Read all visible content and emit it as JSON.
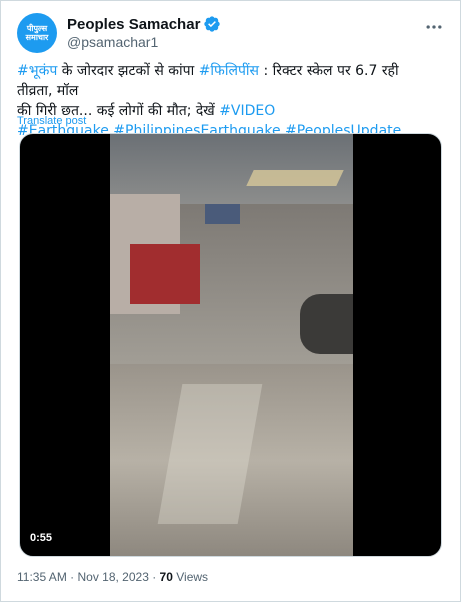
{
  "author": {
    "avatar_line1": "पीपुल्स",
    "avatar_line2": "समाचार",
    "display_name": "Peoples Samachar",
    "handle": "@psamachar1"
  },
  "tweet": {
    "line1_tag": "#भूकंप",
    "line1_text": " के जोरदार झटकों से कांपा ",
    "line1_tag2": "#फिलिपींस",
    "line1_text2": " : रिक्टर स्केल पर 6.7 रही तीव्रता, मॉल",
    "line2_text": "की गिरी छत... कई लोगों की मौत; देखें ",
    "line2_tag": "#VIDEO",
    "line3_tag1": "#Earthquake",
    "line3_tag2": "#PhilippinesEarthquake",
    "line3_tag3": "#PeoplesUpdate",
    "translate_label": "Translate post"
  },
  "video": {
    "time": "0:55"
  },
  "meta": {
    "time": "11:35 AM",
    "date": "Nov 18, 2023",
    "separator": " · ",
    "views_count": "70",
    "views_label": " Views"
  },
  "colors": {
    "accent": "#1d9bf0",
    "text": "#0f1419",
    "muted": "#536471",
    "border": "#cfd9de"
  },
  "icons": {
    "verified": "verified-badge-icon",
    "more": "more-icon"
  }
}
